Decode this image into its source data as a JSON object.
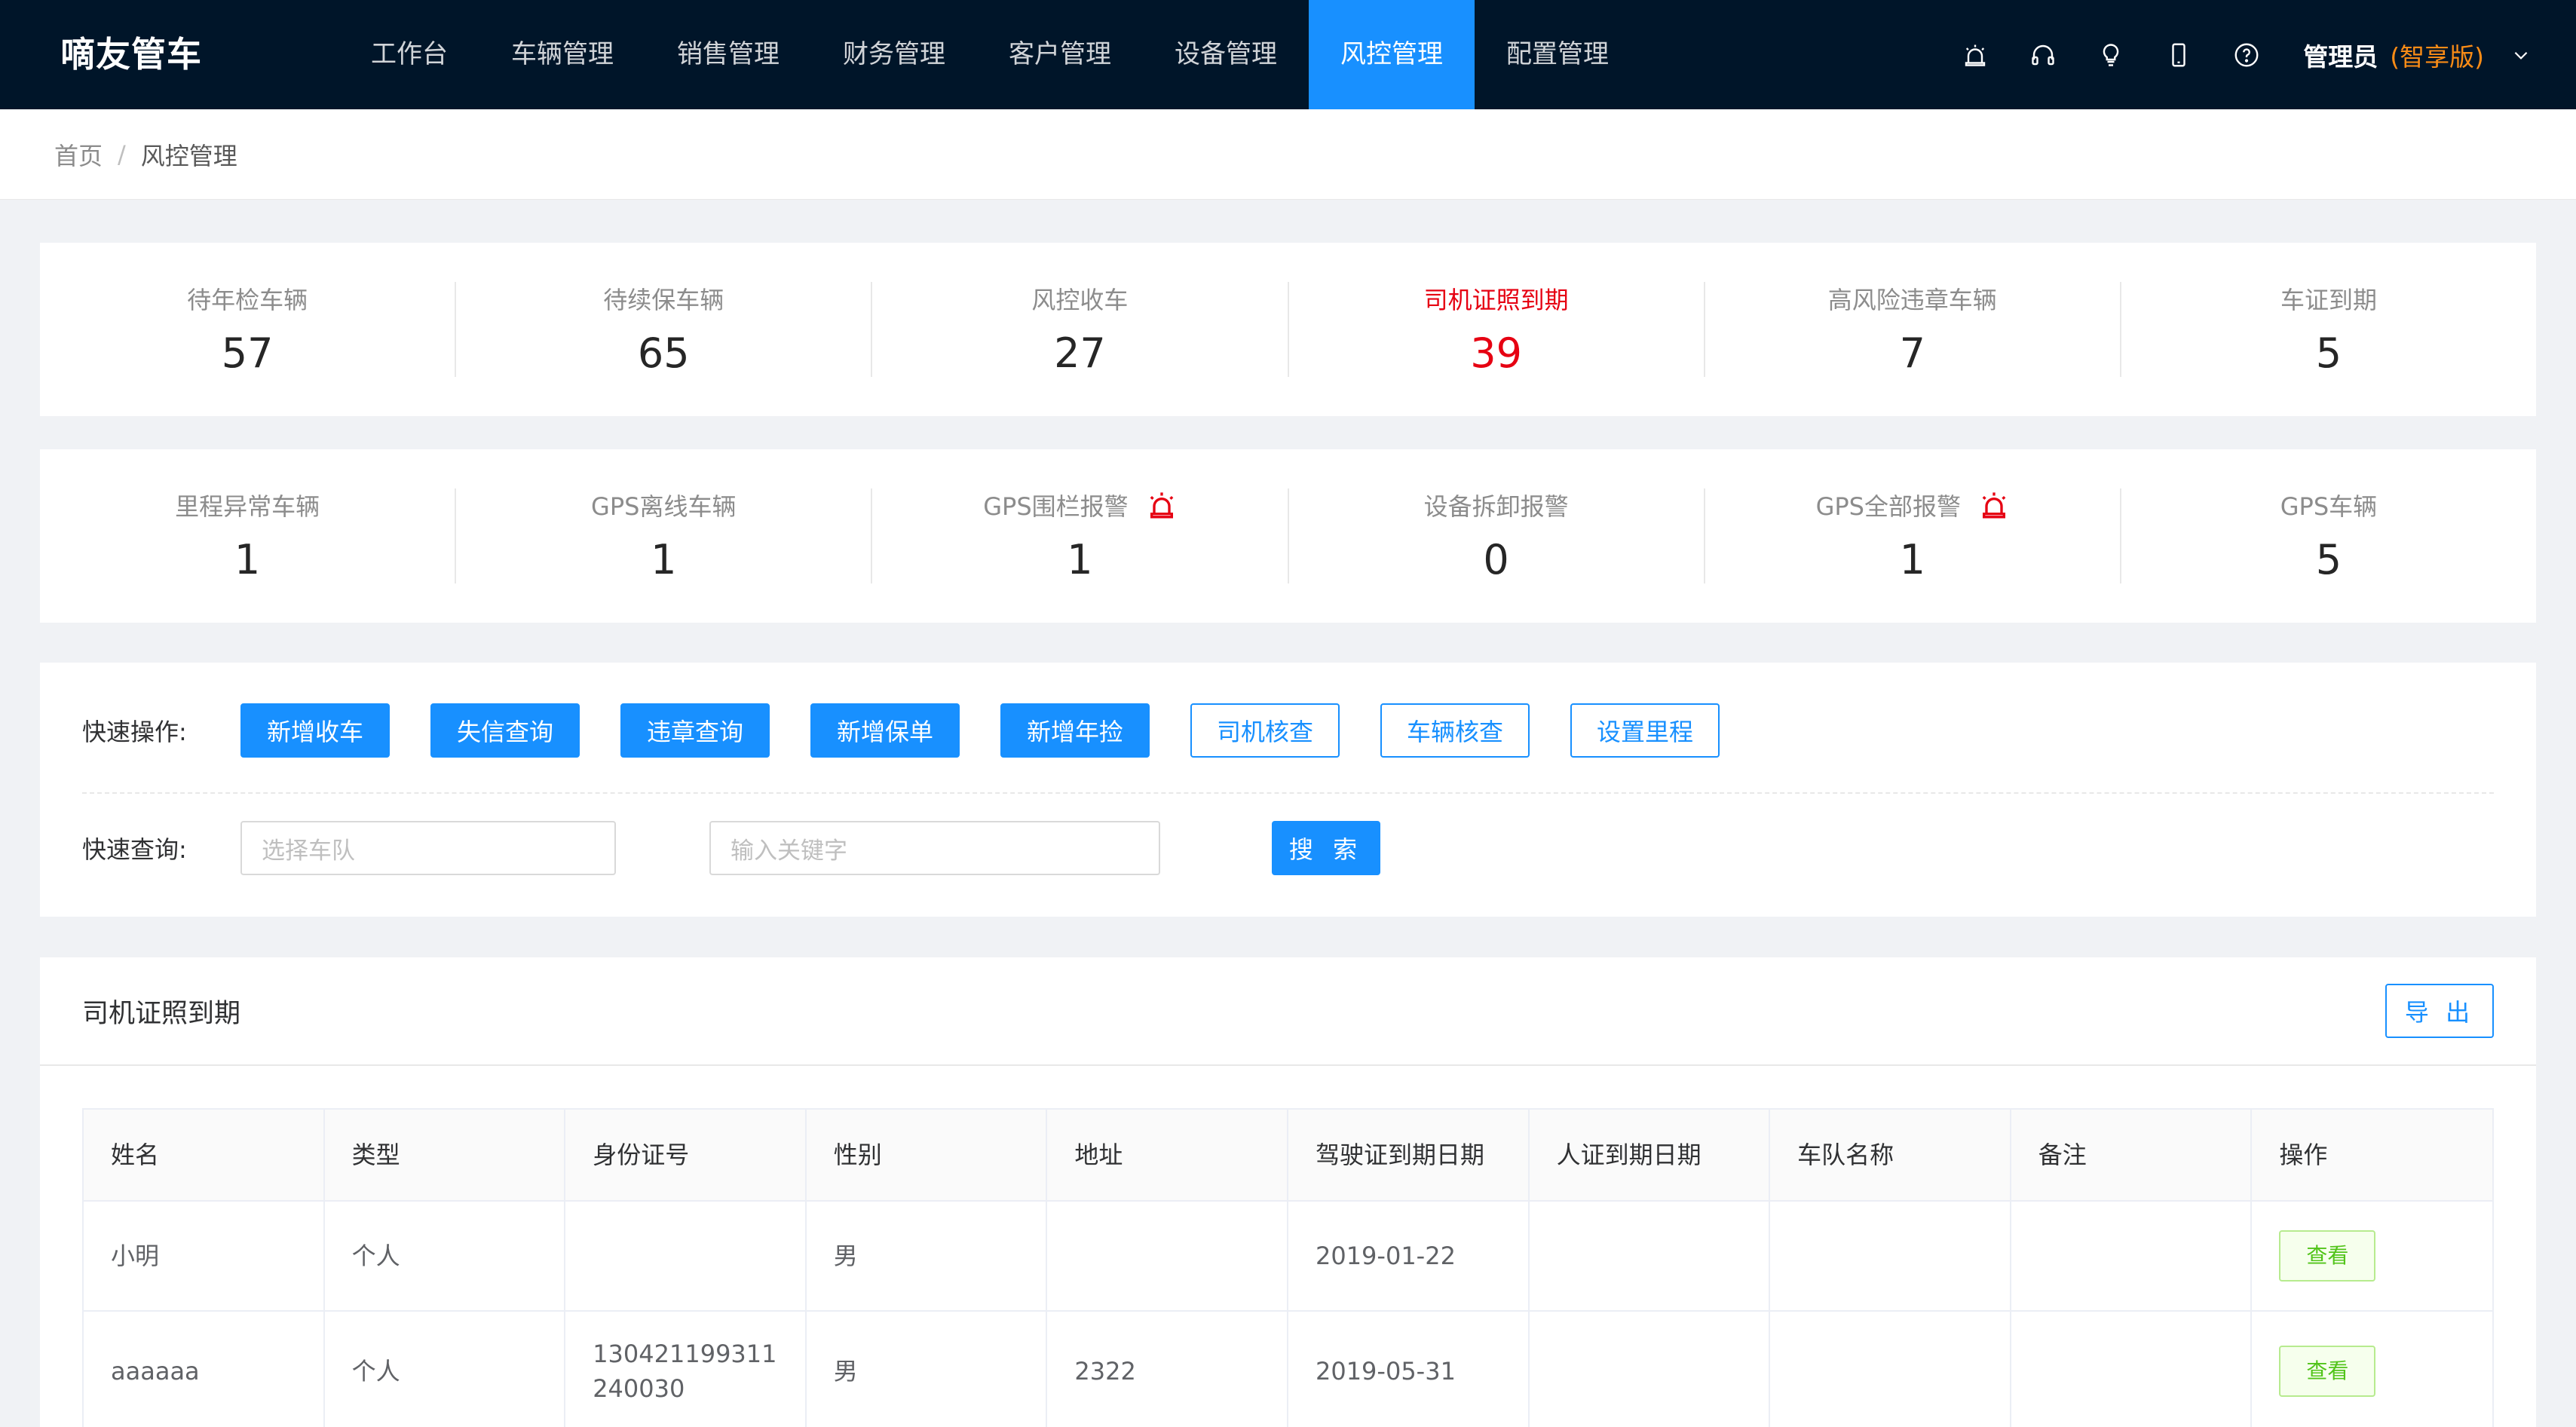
{
  "app": {
    "brand": "嘀友管车"
  },
  "nav": {
    "items": [
      "工作台",
      "车辆管理",
      "销售管理",
      "财务管理",
      "客户管理",
      "设备管理",
      "风控管理",
      "配置管理"
    ],
    "active_index": 6
  },
  "header_icons": [
    "alarm-icon",
    "headset-icon",
    "lightbulb-icon",
    "mobile-icon",
    "help-icon"
  ],
  "user": {
    "name": "管理员",
    "edition": "(智享版)"
  },
  "breadcrumb": {
    "home": "首页",
    "separator": "/",
    "current": "风控管理"
  },
  "stats_row1": [
    {
      "label": "待年检车辆",
      "value": "57"
    },
    {
      "label": "待续保车辆",
      "value": "65"
    },
    {
      "label": "风控收车",
      "value": "27"
    },
    {
      "label": "司机证照到期",
      "value": "39"
    },
    {
      "label": "高风险违章车辆",
      "value": "7"
    },
    {
      "label": "车证到期",
      "value": "5"
    }
  ],
  "stats_row2": [
    {
      "label": "里程异常车辆",
      "value": "1"
    },
    {
      "label": "GPS离线车辆",
      "value": "1"
    },
    {
      "label": "GPS围栏报警",
      "value": "1"
    },
    {
      "label": "设备拆卸报警",
      "value": "0"
    },
    {
      "label": "GPS全部报警",
      "value": "1"
    },
    {
      "label": "GPS车辆",
      "value": "5"
    }
  ],
  "colors": {
    "accent": "#1890ff",
    "danger": "#e60012",
    "nav_bg": "#001529",
    "edition": "#fa8c16"
  },
  "quick_ops": {
    "label": "快速操作:",
    "primary_buttons": [
      "新增收车",
      "失信查询",
      "违章查询",
      "新增保单",
      "新增年捡"
    ],
    "outline_buttons": [
      "司机核查",
      "车辆核查",
      "设置里程"
    ]
  },
  "quick_query": {
    "label": "快速查询:",
    "team_placeholder": "选择车队",
    "keyword_placeholder": "输入关键字",
    "search_label": "搜 索"
  },
  "table_panel": {
    "title": "司机证照到期",
    "export_label": "导 出",
    "columns": [
      "姓名",
      "类型",
      "身份证号",
      "性别",
      "地址",
      "驾驶证到期日期",
      "人证到期日期",
      "车队名称",
      "备注",
      "操作"
    ],
    "rows": [
      {
        "name": "小明",
        "type": "个人",
        "id": "",
        "gender": "男",
        "address": "",
        "license_expiry": "2019-01-22",
        "id_expiry": "",
        "team": "",
        "remark": "",
        "action": "查看"
      },
      {
        "name": "aaaaaa",
        "type": "个人",
        "id": "130421199311240030",
        "gender": "男",
        "address": "2322",
        "license_expiry": "2019-05-31",
        "id_expiry": "",
        "team": "",
        "remark": "",
        "action": "查看"
      }
    ]
  }
}
